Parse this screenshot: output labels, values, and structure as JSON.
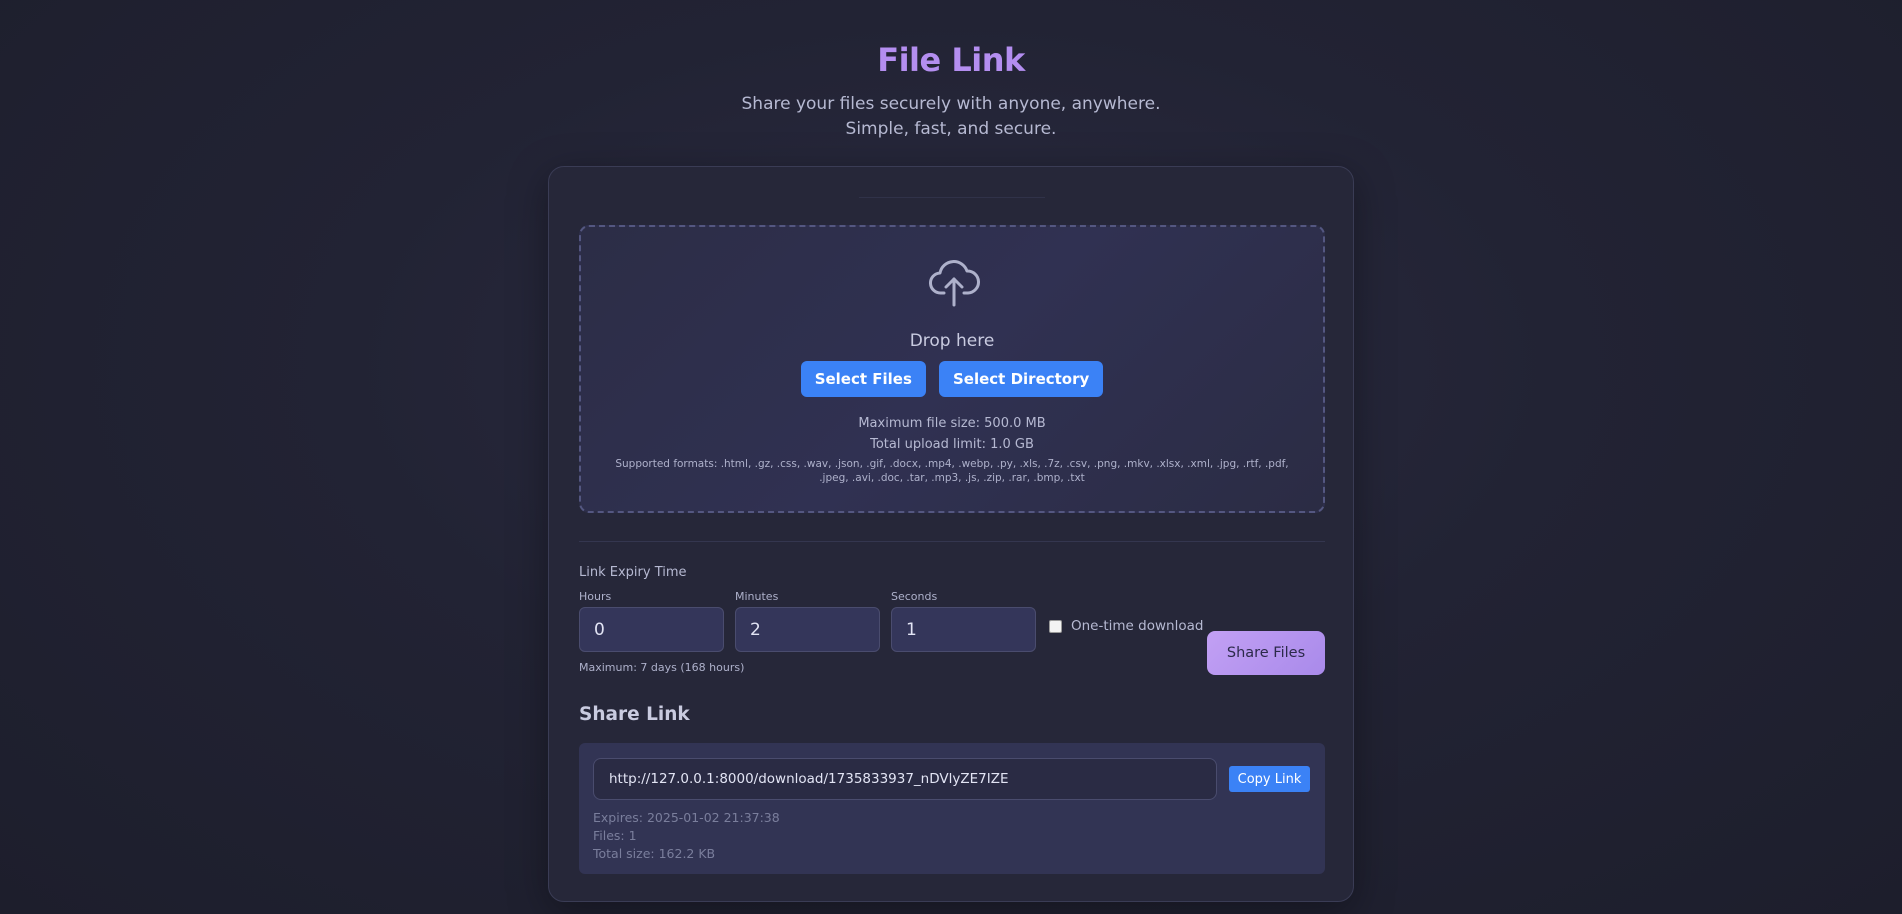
{
  "app": {
    "title": "File Link",
    "subtitle": "Share your files securely with anyone, anywhere. Simple, fast, and secure."
  },
  "upload": {
    "icon": "cloud-upload-icon",
    "drop_label": "Drop here",
    "select_files_label": "Select Files",
    "select_directory_label": "Select Directory",
    "max_file_size": "Maximum file size: 500.0 MB",
    "total_upload_limit": "Total upload limit: 1.0 GB",
    "supported_formats": "Supported formats: .html, .gz, .css, .wav, .json, .gif, .docx, .mp4, .webp, .py, .xls, .7z, .csv, .png, .mkv, .xlsx, .xml, .jpg, .rtf, .pdf, .jpeg, .avi, .doc, .tar, .mp3, .js, .zip, .rar, .bmp, .txt"
  },
  "expiry": {
    "title": "Link Expiry Time",
    "hours_label": "Hours",
    "hours_value": "0",
    "minutes_label": "Minutes",
    "minutes_value": "2",
    "seconds_label": "Seconds",
    "seconds_value": "1",
    "max_note": "Maximum: 7 days (168 hours)",
    "one_time_label": "One-time download",
    "one_time_checked": false,
    "share_button_label": "Share Files"
  },
  "share_link": {
    "heading": "Share Link",
    "url": "http://127.0.0.1:8000/download/1735833937_nDVlyZE7IZE",
    "copy_button_label": "Copy Link",
    "expires": "Expires: 2025-01-02 21:37:38",
    "files": "Files: 1",
    "total_size": "Total size: 162.2 KB"
  },
  "colors": {
    "accent_purple": "#b48ef0",
    "button_blue": "#3b82f6",
    "background": "#222334",
    "card": "#262739"
  }
}
